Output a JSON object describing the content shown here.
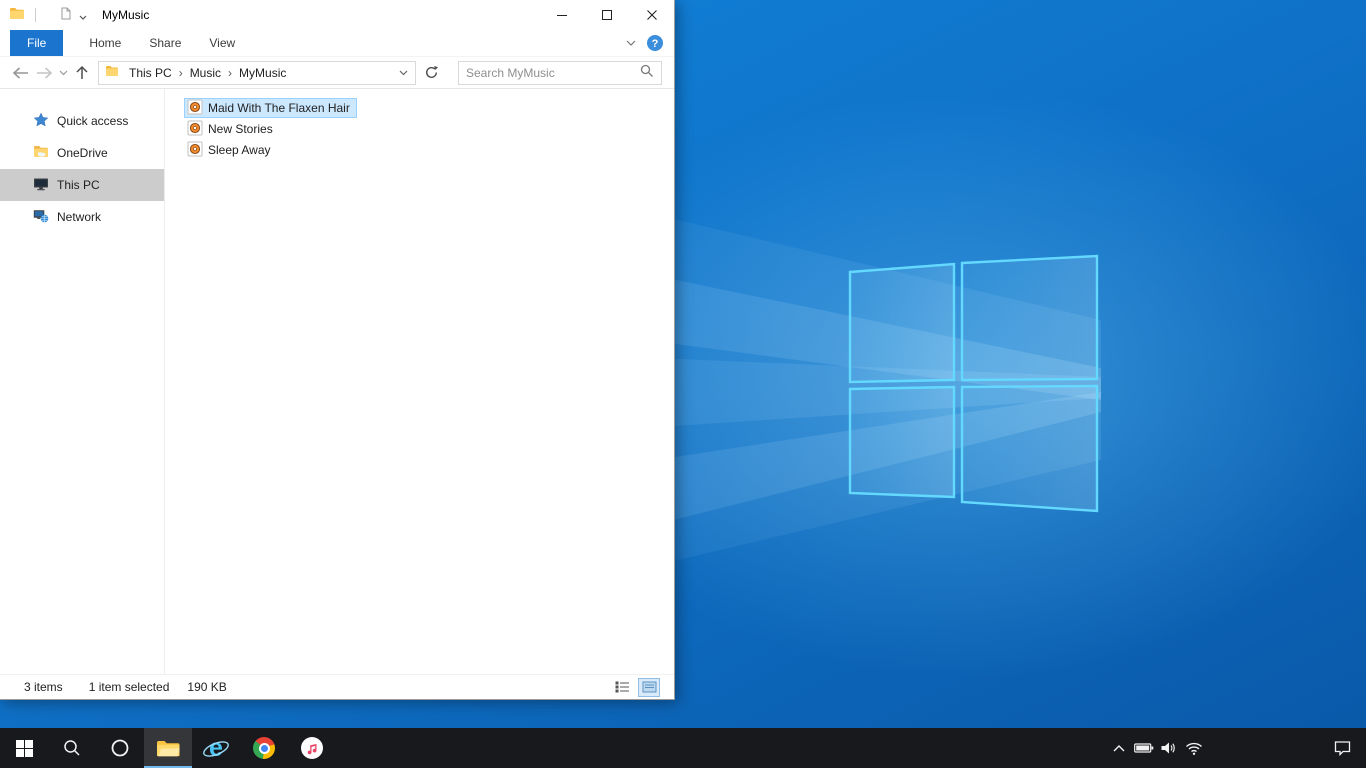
{
  "titlebar": {
    "title": "MyMusic"
  },
  "ribbon": {
    "tabs": [
      {
        "label": "File",
        "active": true
      },
      {
        "label": "Home",
        "active": false
      },
      {
        "label": "Share",
        "active": false
      },
      {
        "label": "View",
        "active": false
      }
    ]
  },
  "address_bar": {
    "breadcrumbs": [
      "This PC",
      "Music",
      "MyMusic"
    ],
    "separator": "›",
    "search_placeholder": "Search MyMusic"
  },
  "sidebar": {
    "items": [
      {
        "label": "Quick access",
        "icon": "star-icon",
        "selected": false
      },
      {
        "label": "OneDrive",
        "icon": "onedrive-folder-icon",
        "selected": false
      },
      {
        "label": "This PC",
        "icon": "computer-icon",
        "selected": true
      },
      {
        "label": "Network",
        "icon": "network-icon",
        "selected": false
      }
    ]
  },
  "files": [
    {
      "name": "Maid With The Flaxen Hair",
      "icon": "audio-file-icon",
      "selected": true
    },
    {
      "name": "New Stories",
      "icon": "audio-file-icon",
      "selected": false
    },
    {
      "name": "Sleep Away",
      "icon": "audio-file-icon",
      "selected": false
    }
  ],
  "status_bar": {
    "item_count": "3 items",
    "selection_count": "1 item selected",
    "selection_size": "190 KB"
  },
  "taskbar": {
    "buttons": [
      "start",
      "search",
      "cortana",
      "file-explorer",
      "internet-explorer",
      "chrome",
      "itunes"
    ],
    "active_button": "file-explorer",
    "tray": [
      "hidden-icons-chevron",
      "battery",
      "speaker",
      "wifi",
      "action-center"
    ]
  },
  "colors": {
    "file_tab_blue": "#1b75cf",
    "selection_fill": "#cce8ff",
    "selection_border": "#99d1ff",
    "sidebar_selected": "#cccccc",
    "taskbar_bg": "#17191d",
    "desktop_top": "#1286dd",
    "desktop_bottom": "#0a58a8",
    "logo_stroke": "#64d9ff"
  }
}
